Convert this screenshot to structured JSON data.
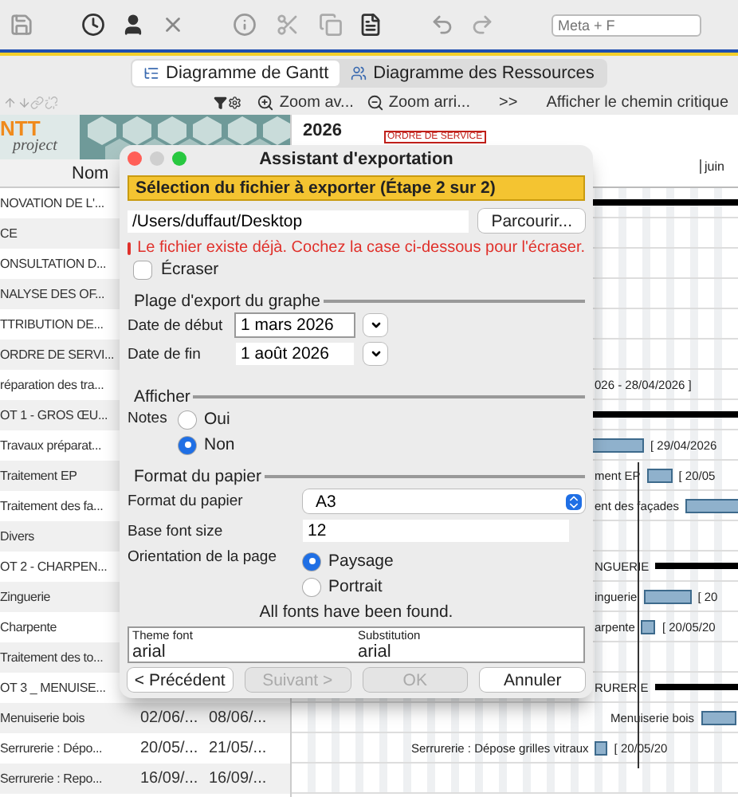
{
  "toolbar": {
    "search": {
      "placeholder": "Meta + F"
    }
  },
  "view_tabs": [
    {
      "label": "Diagramme de Gantt",
      "selected": true
    },
    {
      "label": "Diagramme des Ressources",
      "selected": false
    }
  ],
  "gantt_toolbar": {
    "zoom_in": "Zoom av...",
    "zoom_out": "Zoom arri...",
    "more": ">>",
    "critical_path": "Afficher le chemin critique"
  },
  "logo": {
    "text": "NTT",
    "subtitle": "project"
  },
  "task_table": {
    "column_1": "Nom",
    "rows": [
      {
        "name": "NOVATION DE L'..."
      },
      {
        "name": "CE"
      },
      {
        "name": "ONSULTATION D..."
      },
      {
        "name": "NALYSE DES OF..."
      },
      {
        "name": "TTRIBUTION DE..."
      },
      {
        "name": "ORDRE DE SERVI..."
      },
      {
        "name": "réparation des tra..."
      },
      {
        "name": "OT 1 - GROS ŒU..."
      },
      {
        "name": "Travaux préparat..."
      },
      {
        "name": "Traitement EP"
      },
      {
        "name": "Traitement des fa..."
      },
      {
        "name": "Divers"
      },
      {
        "name": "OT 2 - CHARPEN..."
      },
      {
        "name": "Zinguerie"
      },
      {
        "name": "Charpente"
      },
      {
        "name": "Traitement des to..."
      },
      {
        "name": "OT 3 _ MENUISE..."
      },
      {
        "name": "Menuiserie bois",
        "start": "02/06/...",
        "end": "08/06/..."
      },
      {
        "name": "Serrurerie : Dépo...",
        "start": "20/05/...",
        "end": "21/05/..."
      },
      {
        "name": "Serrurerie : Repo...",
        "start": "16/09/...",
        "end": "16/09/..."
      }
    ]
  },
  "chart": {
    "year": "2026",
    "milestone": "ORDRE DE SERVICE",
    "month": "juin",
    "rows": [
      {
        "kind": "summary"
      },
      {
        "kind": "empty"
      },
      {
        "kind": "empty"
      },
      {
        "kind": "empty"
      },
      {
        "kind": "empty"
      },
      {
        "kind": "empty"
      },
      {
        "kind": "label",
        "right_label": "026 - 28/04/2026 ]"
      },
      {
        "kind": "summary"
      },
      {
        "kind": "task",
        "right_label": "[ 29/04/2026"
      },
      {
        "kind": "task",
        "left_label": "ment EP",
        "right_label": "[ 20/05"
      },
      {
        "kind": "task",
        "left_label": "ent des façades"
      },
      {
        "kind": "empty"
      },
      {
        "kind": "summary",
        "left_label": "NGUERIE"
      },
      {
        "kind": "task",
        "left_label": "inguerie",
        "right_label": "[ 20"
      },
      {
        "kind": "task",
        "left_label": "arpente",
        "right_label": "[ 20/05/20"
      },
      {
        "kind": "empty"
      },
      {
        "kind": "summary",
        "left_label": "RURERIE"
      },
      {
        "kind": "task",
        "left_label": "Menuiserie bois"
      },
      {
        "kind": "task",
        "left_label": "Serrurerie : Dépose grilles vitraux",
        "right_label": "[ 20/05/20"
      },
      {
        "kind": "empty"
      }
    ]
  },
  "dialog": {
    "title": "Assistant d'exportation",
    "step_banner": "Sélection du fichier à exporter (Étape 2 sur 2)",
    "file_path": {
      "value": "/Users/duffaut/Desktop"
    },
    "browse_button": "Parcourir...",
    "error": "Le fichier existe déjà. Cochez la case ci-dessous pour l'écraser.",
    "overwrite": {
      "label": "Écraser",
      "checked": false
    },
    "range_group": {
      "title": "Plage d'export du graphe",
      "start": {
        "label": "Date de début",
        "value": "1 mars 2026"
      },
      "end": {
        "label": "Date de fin",
        "value": "1 août 2026"
      }
    },
    "display_group": {
      "title": "Afficher",
      "notes": {
        "label": "Notes",
        "options": [
          {
            "label": "Oui",
            "selected": false
          },
          {
            "label": "Non",
            "selected": true
          }
        ]
      }
    },
    "paper_group": {
      "title": "Format du papier",
      "paper_format": {
        "label": "Format du papier",
        "value": "A3"
      },
      "base_font_size": {
        "label": "Base font size",
        "value": "12"
      },
      "orientation": {
        "label": "Orientation de la page",
        "options": [
          {
            "label": "Paysage",
            "selected": true
          },
          {
            "label": "Portrait",
            "selected": false
          }
        ]
      }
    },
    "fonts_status": "All fonts have been found.",
    "font_table": {
      "columns": [
        "Theme font",
        "Substitution"
      ],
      "rows": [
        [
          "arial",
          "arial"
        ]
      ]
    },
    "buttons": [
      {
        "label": "< Précédent",
        "disabled": false
      },
      {
        "label": "Suivant >",
        "disabled": true
      },
      {
        "label": "OK",
        "disabled": true
      },
      {
        "label": "Annuler",
        "disabled": false
      }
    ]
  }
}
